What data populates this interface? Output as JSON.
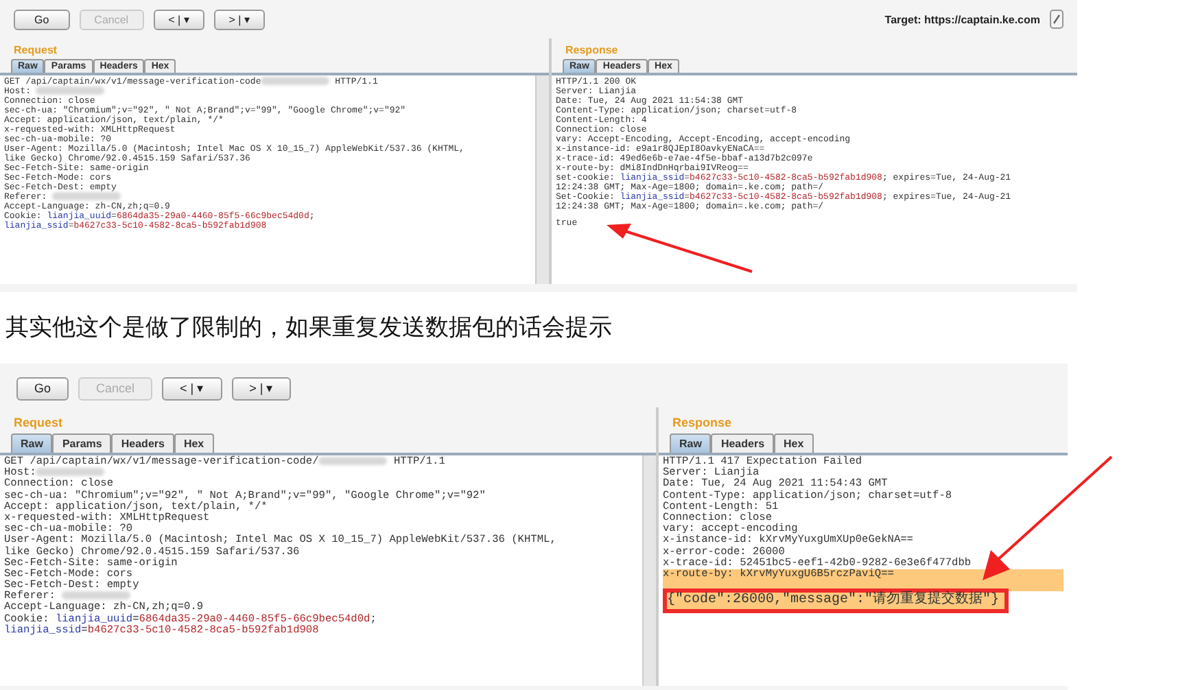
{
  "screenshots": [
    {
      "toolbar": {
        "buttons": [
          {
            "label": "Go",
            "disabled": false
          },
          {
            "label": "Cancel",
            "disabled": true
          },
          {
            "label": "< | ▾",
            "disabled": false
          },
          {
            "label": "> | ▾",
            "disabled": false
          }
        ],
        "target": "Target: https://captain.ke.com"
      },
      "request": {
        "title": "Request",
        "tabs": [
          {
            "label": "Raw",
            "selected": true
          },
          {
            "label": "Params",
            "selected": false
          },
          {
            "label": "Headers",
            "selected": false
          },
          {
            "label": "Hex",
            "selected": false
          }
        ],
        "lines": [
          {
            "parts": [
              {
                "kind": "plain",
                "text": "GET /api/captain/wx/v1/message-verification-code"
              },
              {
                "kind": "redacted"
              },
              {
                "kind": "plain",
                "text": " HTTP/1.1"
              }
            ]
          },
          {
            "parts": [
              {
                "kind": "plain",
                "text": "Host: "
              },
              {
                "kind": "redacted"
              }
            ]
          },
          {
            "parts": [
              {
                "kind": "plain",
                "text": "Connection: close"
              }
            ]
          },
          {
            "parts": [
              {
                "kind": "plain",
                "text": "sec-ch-ua: \"Chromium\";v=\"92\", \" Not A;Brand\";v=\"99\", \"Google Chrome\";v=\"92\""
              }
            ]
          },
          {
            "parts": [
              {
                "kind": "plain",
                "text": "Accept: application/json, text/plain, */*"
              }
            ]
          },
          {
            "parts": [
              {
                "kind": "plain",
                "text": "x-requested-with: XMLHttpRequest"
              }
            ]
          },
          {
            "parts": [
              {
                "kind": "plain",
                "text": "sec-ch-ua-mobile: ?0"
              }
            ]
          },
          {
            "parts": [
              {
                "kind": "plain",
                "text": "User-Agent: Mozilla/5.0 (Macintosh; Intel Mac OS X 10_15_7) AppleWebKit/537.36 (KHTML,"
              }
            ]
          },
          {
            "parts": [
              {
                "kind": "plain",
                "text": "like Gecko) Chrome/92.0.4515.159 Safari/537.36"
              }
            ]
          },
          {
            "parts": [
              {
                "kind": "plain",
                "text": "Sec-Fetch-Site: same-origin"
              }
            ]
          },
          {
            "parts": [
              {
                "kind": "plain",
                "text": "Sec-Fetch-Mode: cors"
              }
            ]
          },
          {
            "parts": [
              {
                "kind": "plain",
                "text": "Sec-Fetch-Dest: empty"
              }
            ]
          },
          {
            "parts": [
              {
                "kind": "plain",
                "text": "Referer: "
              },
              {
                "kind": "redacted"
              }
            ]
          },
          {
            "parts": [
              {
                "kind": "plain",
                "text": "Accept-Language: zh-CN,zh;q=0.9"
              }
            ]
          },
          {
            "parts": [
              {
                "kind": "plain",
                "text": "Cookie: "
              },
              {
                "kind": "name",
                "text": "lianjia_uuid"
              },
              {
                "kind": "plain",
                "text": "="
              },
              {
                "kind": "value",
                "text": "6864da35-29a0-4460-85f5-66c9bec54d0d"
              },
              {
                "kind": "plain",
                "text": ";"
              }
            ]
          },
          {
            "parts": [
              {
                "kind": "name",
                "text": "lianjia_ssid"
              },
              {
                "kind": "plain",
                "text": "="
              },
              {
                "kind": "value",
                "text": "b4627c33-5c10-4582-8ca5-b592fab1d908"
              }
            ]
          }
        ]
      },
      "response": {
        "title": "Response",
        "tabs": [
          {
            "label": "Raw",
            "selected": true
          },
          {
            "label": "Headers",
            "selected": false
          },
          {
            "label": "Hex",
            "selected": false
          }
        ],
        "lines": [
          {
            "parts": [
              {
                "kind": "plain",
                "text": "HTTP/1.1 200 OK"
              }
            ]
          },
          {
            "parts": [
              {
                "kind": "plain",
                "text": "Server: Lianjia"
              }
            ]
          },
          {
            "parts": [
              {
                "kind": "plain",
                "text": "Date: Tue, 24 Aug 2021 11:54:38 GMT"
              }
            ]
          },
          {
            "parts": [
              {
                "kind": "plain",
                "text": "Content-Type: application/json; charset=utf-8"
              }
            ]
          },
          {
            "parts": [
              {
                "kind": "plain",
                "text": "Content-Length: 4"
              }
            ]
          },
          {
            "parts": [
              {
                "kind": "plain",
                "text": "Connection: close"
              }
            ]
          },
          {
            "parts": [
              {
                "kind": "plain",
                "text": "vary: Accept-Encoding, Accept-Encoding, accept-encoding"
              }
            ]
          },
          {
            "parts": [
              {
                "kind": "plain",
                "text": "x-instance-id: e9a1r8QJEpI8OavkyENaCA=="
              }
            ]
          },
          {
            "parts": [
              {
                "kind": "plain",
                "text": "x-trace-id: 49ed6e6b-e7ae-4f5e-bbaf-a13d7b2c097e"
              }
            ]
          },
          {
            "parts": [
              {
                "kind": "plain",
                "text": "x-route-by: dMi8IndDnHqrbai9IVReog=="
              }
            ]
          },
          {
            "parts": [
              {
                "kind": "plain",
                "text": "set-cookie: "
              },
              {
                "kind": "name",
                "text": "lianjia_ssid"
              },
              {
                "kind": "plain",
                "text": "="
              },
              {
                "kind": "value",
                "text": "b4627c33-5c10-4582-8ca5-b592fab1d908"
              },
              {
                "kind": "plain",
                "text": "; expires=Tue, 24-Aug-21"
              }
            ]
          },
          {
            "parts": [
              {
                "kind": "plain",
                "text": "12:24:38 GMT; Max-Age=1800; domain=.ke.com; path=/"
              }
            ]
          },
          {
            "parts": [
              {
                "kind": "plain",
                "text": "Set-Cookie: "
              },
              {
                "kind": "name",
                "text": "lianjia_ssid"
              },
              {
                "kind": "plain",
                "text": "="
              },
              {
                "kind": "value",
                "text": "b4627c33-5c10-4582-8ca5-b592fab1d908"
              },
              {
                "kind": "plain",
                "text": "; expires=Tue, 24-Aug-21"
              }
            ]
          },
          {
            "parts": [
              {
                "kind": "plain",
                "text": "12:24:38 GMT; Max-Age=1800; domain=.ke.com; path=/"
              }
            ]
          },
          {
            "blank": true
          },
          {
            "parts": [
              {
                "kind": "plain",
                "text": "true"
              }
            ]
          }
        ]
      }
    },
    {
      "toolbar": {
        "buttons": [
          {
            "label": "Go",
            "disabled": false
          },
          {
            "label": "Cancel",
            "disabled": true
          },
          {
            "label": "< | ▾",
            "disabled": false
          },
          {
            "label": "> | ▾",
            "disabled": false
          }
        ]
      },
      "request": {
        "title": "Request",
        "tabs": [
          {
            "label": "Raw",
            "selected": true
          },
          {
            "label": "Params",
            "selected": false
          },
          {
            "label": "Headers",
            "selected": false
          },
          {
            "label": "Hex",
            "selected": false
          }
        ],
        "lines": [
          {
            "parts": [
              {
                "kind": "plain",
                "text": "GET /api/captain/wx/v1/message-verification-code/"
              },
              {
                "kind": "redacted"
              },
              {
                "kind": "plain",
                "text": " HTTP/1.1"
              }
            ]
          },
          {
            "parts": [
              {
                "kind": "plain",
                "text": "Host:"
              },
              {
                "kind": "redacted"
              }
            ]
          },
          {
            "parts": [
              {
                "kind": "plain",
                "text": "Connection: close"
              }
            ]
          },
          {
            "parts": [
              {
                "kind": "plain",
                "text": "sec-ch-ua: \"Chromium\";v=\"92\", \" Not A;Brand\";v=\"99\", \"Google Chrome\";v=\"92\""
              }
            ]
          },
          {
            "parts": [
              {
                "kind": "plain",
                "text": "Accept: application/json, text/plain, */*"
              }
            ]
          },
          {
            "parts": [
              {
                "kind": "plain",
                "text": "x-requested-with: XMLHttpRequest"
              }
            ]
          },
          {
            "parts": [
              {
                "kind": "plain",
                "text": "sec-ch-ua-mobile: ?0"
              }
            ]
          },
          {
            "parts": [
              {
                "kind": "plain",
                "text": "User-Agent: Mozilla/5.0 (Macintosh; Intel Mac OS X 10_15_7) AppleWebKit/537.36 (KHTML,"
              }
            ]
          },
          {
            "parts": [
              {
                "kind": "plain",
                "text": "like Gecko) Chrome/92.0.4515.159 Safari/537.36"
              }
            ]
          },
          {
            "parts": [
              {
                "kind": "plain",
                "text": "Sec-Fetch-Site: same-origin"
              }
            ]
          },
          {
            "parts": [
              {
                "kind": "plain",
                "text": "Sec-Fetch-Mode: cors"
              }
            ]
          },
          {
            "parts": [
              {
                "kind": "plain",
                "text": "Sec-Fetch-Dest: empty"
              }
            ]
          },
          {
            "parts": [
              {
                "kind": "plain",
                "text": "Referer: "
              },
              {
                "kind": "redacted"
              }
            ]
          },
          {
            "parts": [
              {
                "kind": "plain",
                "text": "Accept-Language: zh-CN,zh;q=0.9"
              }
            ]
          },
          {
            "parts": [
              {
                "kind": "plain",
                "text": "Cookie: "
              },
              {
                "kind": "name",
                "text": "lianjia_uuid"
              },
              {
                "kind": "plain",
                "text": "="
              },
              {
                "kind": "value",
                "text": "6864da35-29a0-4460-85f5-66c9bec54d0d"
              },
              {
                "kind": "plain",
                "text": ";"
              }
            ]
          },
          {
            "parts": [
              {
                "kind": "name",
                "text": "lianjia_ssid"
              },
              {
                "kind": "plain",
                "text": "="
              },
              {
                "kind": "value",
                "text": "b4627c33-5c10-4582-8ca5-b592fab1d908"
              }
            ]
          }
        ]
      },
      "response": {
        "title": "Response",
        "tabs": [
          {
            "label": "Raw",
            "selected": true
          },
          {
            "label": "Headers",
            "selected": false
          },
          {
            "label": "Hex",
            "selected": false
          }
        ],
        "lines": [
          {
            "highlighted": false,
            "boxed": false,
            "parts": [
              {
                "kind": "plain",
                "text": "HTTP/1.1 417 Expectation Failed"
              }
            ]
          },
          {
            "highlighted": false,
            "boxed": false,
            "parts": [
              {
                "kind": "plain",
                "text": "Server: Lianjia"
              }
            ]
          },
          {
            "highlighted": false,
            "boxed": false,
            "parts": [
              {
                "kind": "plain",
                "text": "Date: Tue, 24 Aug 2021 11:54:43 GMT"
              }
            ]
          },
          {
            "highlighted": false,
            "boxed": false,
            "parts": [
              {
                "kind": "plain",
                "text": "Content-Type: application/json; charset=utf-8"
              }
            ]
          },
          {
            "highlighted": false,
            "boxed": false,
            "parts": [
              {
                "kind": "plain",
                "text": "Content-Length: 51"
              }
            ]
          },
          {
            "highlighted": false,
            "boxed": false,
            "parts": [
              {
                "kind": "plain",
                "text": "Connection: close"
              }
            ]
          },
          {
            "highlighted": false,
            "boxed": false,
            "parts": [
              {
                "kind": "plain",
                "text": "vary: accept-encoding"
              }
            ]
          },
          {
            "highlighted": false,
            "boxed": false,
            "parts": [
              {
                "kind": "plain",
                "text": "x-instance-id: kXrvMyYuxgUmXUp0eGekNA=="
              }
            ]
          },
          {
            "highlighted": false,
            "boxed": false,
            "parts": [
              {
                "kind": "plain",
                "text": "x-error-code: 26000"
              }
            ]
          },
          {
            "highlighted": false,
            "boxed": false,
            "parts": [
              {
                "kind": "plain",
                "text": "x-trace-id: 52451bc5-eef1-42b0-9282-6e3e6f477dbb"
              }
            ]
          },
          {
            "highlighted": true,
            "boxed": false,
            "parts": [
              {
                "kind": "plain",
                "text": "x-route-by: kXrvMyYuxgU6B5rczPaviQ=="
              }
            ]
          },
          {
            "highlighted": true,
            "boxed": false
          },
          {
            "highlighted": true,
            "boxed": true,
            "parts": [
              {
                "kind": "plain",
                "text": "{\"code\":26000,\"message\":\"请勿重复提交数据\"}"
              }
            ]
          }
        ]
      }
    }
  ],
  "paragraph": "其实他这个是做了限制的，如果重复发送数据包的话会提示"
}
